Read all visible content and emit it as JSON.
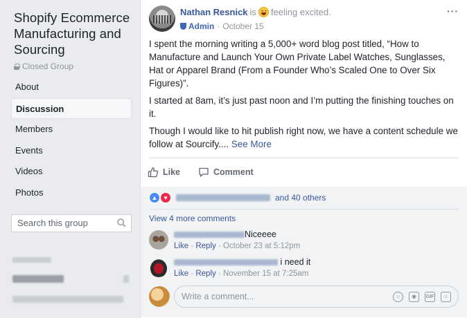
{
  "sidebar": {
    "group_name": "Shopify Ecommerce Manufacturing and Sourcing",
    "privacy": "Closed Group",
    "nav": [
      {
        "label": "About"
      },
      {
        "label": "Discussion"
      },
      {
        "label": "Members"
      },
      {
        "label": "Events"
      },
      {
        "label": "Videos"
      },
      {
        "label": "Photos"
      }
    ],
    "search_placeholder": "Search this group"
  },
  "post": {
    "author": "Nathan Resnick",
    "is_text": "is",
    "feeling": "feeling excited.",
    "role": "Admin",
    "date": "October 15",
    "more": "···",
    "paragraphs": [
      "I spent the morning writing a 5,000+ word blog post titled, “How to Manufacture and Launch Your Own Private Label Watches, Sunglasses, Hat or Apparel Brand (From a Founder Who’s Scaled One to Over Six Figures)”.",
      "I started at 8am, it’s just past noon and I’m putting the finishing touches on it.",
      "Though I would like to hit publish right now, we have a content schedule we follow at Sourcify...."
    ],
    "see_more": "See More",
    "like_label": "Like",
    "comment_label": "Comment",
    "reactions_suffix": "and 40 others",
    "view_more_comments": "View 4 more comments"
  },
  "comments": [
    {
      "text": "Niceeee",
      "like": "Like",
      "reply": "Reply",
      "time": "October 23 at 5:12pm"
    },
    {
      "text": "i need it",
      "like": "Like",
      "reply": "Reply",
      "time": "November 15 at 7:25am"
    }
  ],
  "composer": {
    "placeholder": "Write a comment...",
    "icons": [
      "emoji-icon",
      "camera-icon",
      "gif-icon",
      "sticker-icon"
    ],
    "gif": "GIF"
  },
  "colors": {
    "link": "#385898",
    "background": "#e9ebee",
    "like_blue": "#4a89f3",
    "love_red": "#f0284a"
  }
}
